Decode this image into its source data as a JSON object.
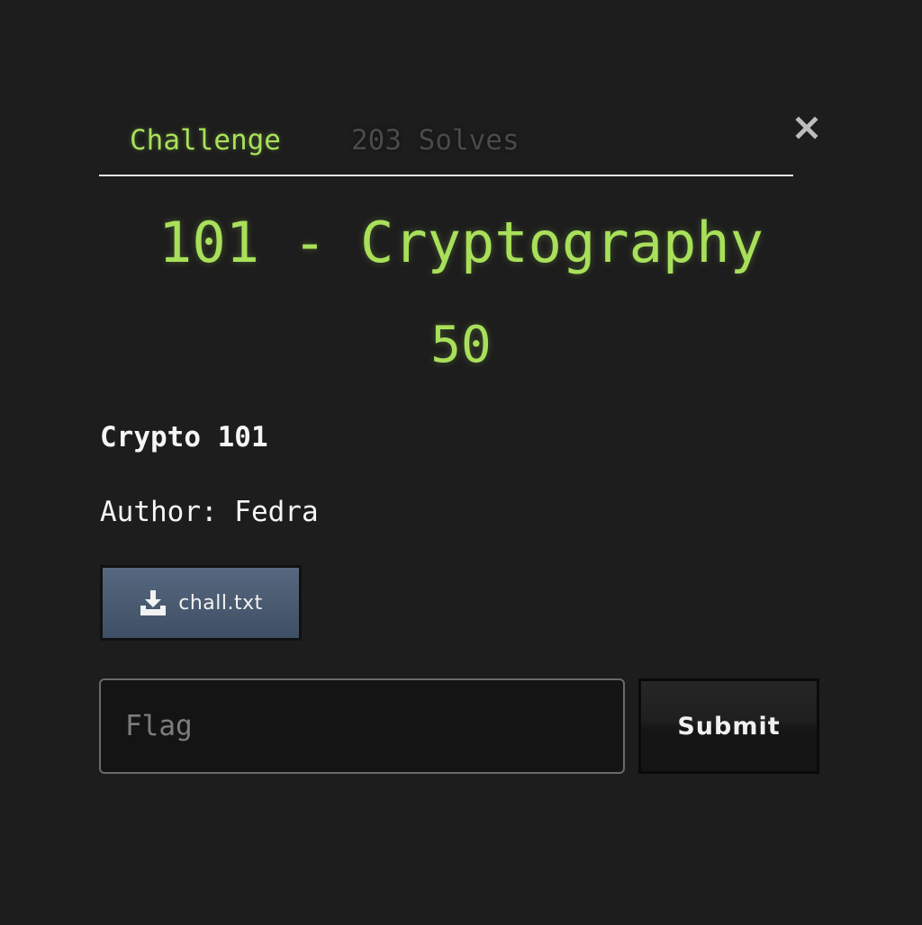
{
  "modal": {
    "close_icon": "close-icon"
  },
  "tabs": {
    "challenge_label": "Challenge",
    "solves_label": "203 Solves"
  },
  "challenge": {
    "title": "101 - Cryptography",
    "points": "50",
    "description_heading": "Crypto 101",
    "description_author": "Author: Fedra"
  },
  "files": {
    "items": [
      {
        "name": "chall.txt",
        "icon": "download-icon"
      }
    ]
  },
  "submission": {
    "flag_placeholder": "Flag",
    "flag_value": "",
    "submit_label": "Submit"
  },
  "colors": {
    "accent": "#a9e05a",
    "background": "#1d1d1d",
    "file_button": "#4a5b72"
  }
}
